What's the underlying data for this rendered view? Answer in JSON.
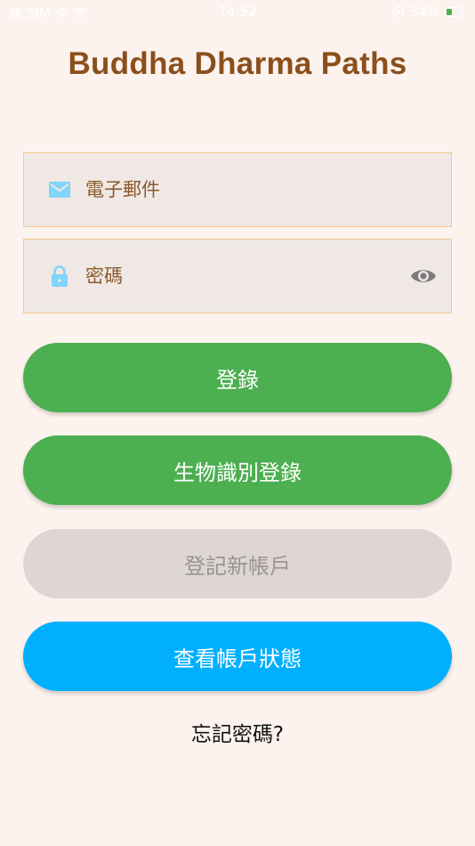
{
  "status_bar": {
    "carrier": "無 SIM 卡",
    "time": "14:52",
    "battery": "34%"
  },
  "app": {
    "title": "Buddha Dharma Paths"
  },
  "form": {
    "email": {
      "placeholder": "電子郵件",
      "value": "",
      "icon": "mail-icon"
    },
    "password": {
      "placeholder": "密碼",
      "value": "",
      "icon": "lock-icon",
      "toggle_icon": "eye-icon"
    }
  },
  "buttons": {
    "login": "登錄",
    "biometric_login": "生物識別登錄",
    "register": "登記新帳戶",
    "account_status": "查看帳戶狀態"
  },
  "links": {
    "forgot_password": "忘記密碼?"
  },
  "colors": {
    "background": "#fdf3ee",
    "title": "#8b4f1c",
    "field_bg": "#f0e8e4",
    "field_border": "#f7c98c",
    "icon": "#81d4fa",
    "green": "#4caf50",
    "disabled": "#ddd6d3",
    "blue": "#00b0ff"
  }
}
